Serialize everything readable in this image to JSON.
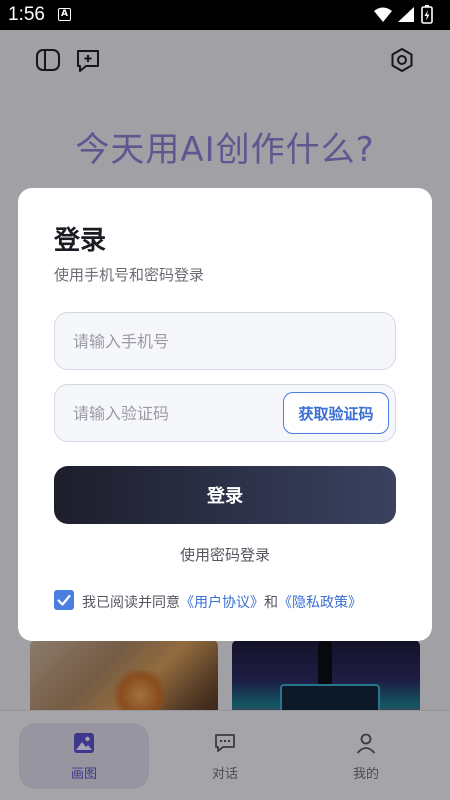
{
  "status": {
    "time": "1:56",
    "notification_glyph": "A"
  },
  "app": {
    "headline": "今天用AI创作什么?",
    "nav": [
      {
        "label": "画图",
        "icon": "image-icon",
        "active": true
      },
      {
        "label": "对话",
        "icon": "chat-icon",
        "active": false
      },
      {
        "label": "我的",
        "icon": "user-icon",
        "active": false
      }
    ]
  },
  "dialog": {
    "title": "登录",
    "subtitle": "使用手机号和密码登录",
    "phone_placeholder": "请输入手机号",
    "code_placeholder": "请输入验证码",
    "get_code_label": "获取验证码",
    "login_label": "登录",
    "password_login_label": "使用密码登录",
    "agreement": {
      "prefix": "我已阅读并同意",
      "user_agreement": "《用户协议》",
      "conjunction": "和",
      "privacy_policy": "《隐私政策》",
      "checked": true
    }
  },
  "colors": {
    "accent": "#4a7fe0",
    "headline": "#8a7ccf",
    "nav_active": "#5a4fc8"
  }
}
